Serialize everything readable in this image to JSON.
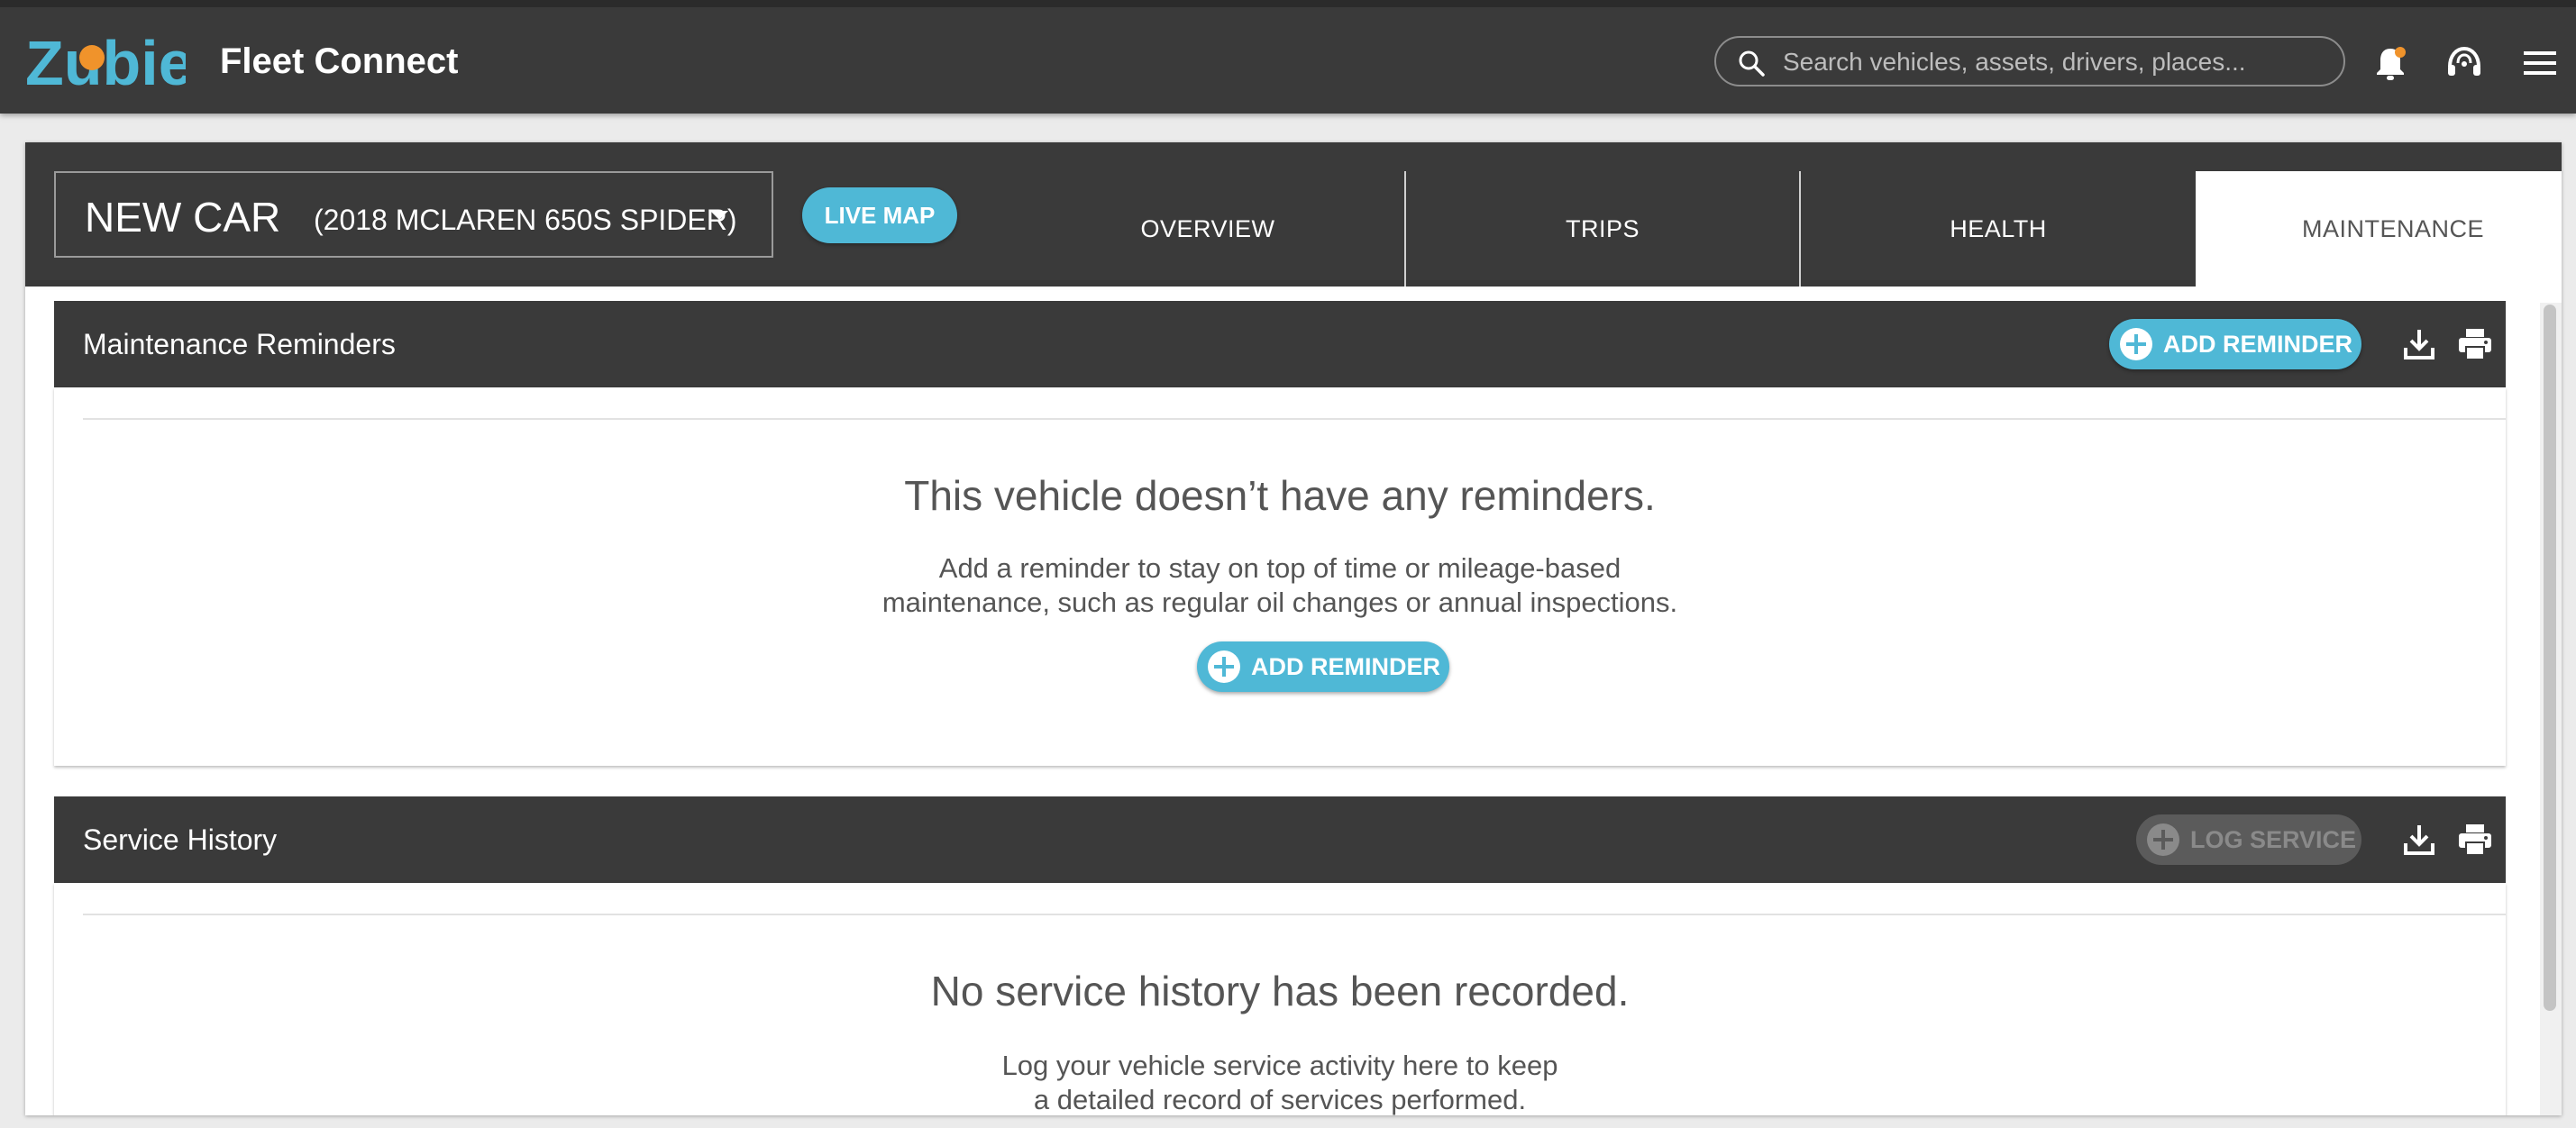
{
  "app": {
    "logo_text": "Zubie",
    "title": "Fleet Connect"
  },
  "search": {
    "placeholder": "Search vehicles, assets, drivers, places..."
  },
  "colors": {
    "accent": "#4fb8d6",
    "topbar": "#3a3a3a",
    "notification_dot": "#f0932b"
  },
  "topbar_icons": [
    "bell-icon",
    "headset-icon",
    "menu-icon"
  ],
  "vehicle": {
    "name": "NEW CAR",
    "model": "(2018 MCLAREN 650S SPIDER)"
  },
  "live_map_label": "LIVE MAP",
  "tabs": [
    {
      "label": "OVERVIEW",
      "active": false
    },
    {
      "label": "TRIPS",
      "active": false
    },
    {
      "label": "HEALTH",
      "active": false
    },
    {
      "label": "MAINTENANCE",
      "active": true
    }
  ],
  "reminders": {
    "title": "Maintenance Reminders",
    "add_label": "ADD REMINDER",
    "empty_title": "This vehicle doesn’t have any reminders.",
    "empty_line1": "Add a reminder to stay on top of time or mileage-based",
    "empty_line2": "maintenance, such as regular oil changes or annual inspections.",
    "empty_button": "ADD REMINDER"
  },
  "service_history": {
    "title": "Service History",
    "log_label": "LOG SERVICE",
    "empty_title": "No service history has been recorded.",
    "empty_line1": "Log your vehicle service activity here to keep",
    "empty_line2": "a detailed record of services performed."
  }
}
